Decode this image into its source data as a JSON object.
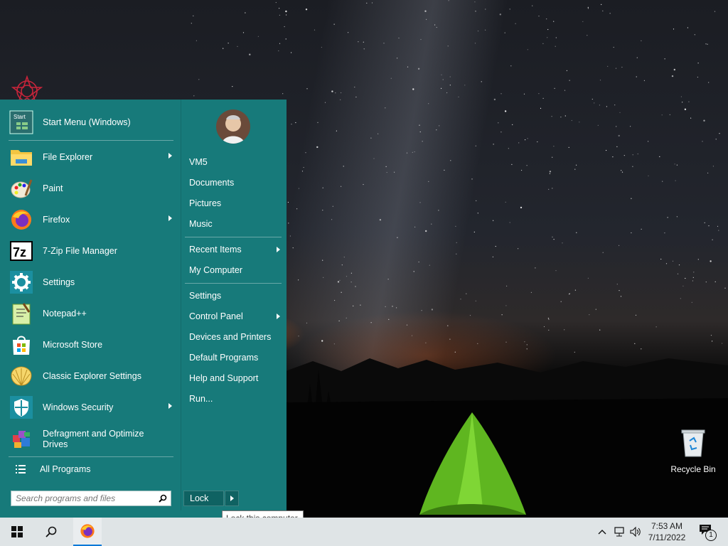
{
  "desktop": {
    "recycle_bin_label": "Recycle Bin"
  },
  "start_menu": {
    "header_item": {
      "label": "Start Menu (Windows)",
      "icon": "start-menu-icon"
    },
    "programs": [
      {
        "label": "File Explorer",
        "icon": "folder-icon",
        "has_submenu": true
      },
      {
        "label": "Paint",
        "icon": "paint-palette-icon",
        "has_submenu": false
      },
      {
        "label": "Firefox",
        "icon": "firefox-icon",
        "has_submenu": true
      },
      {
        "label": "7-Zip File Manager",
        "icon": "7zip-icon",
        "has_submenu": false
      },
      {
        "label": "Settings",
        "icon": "gear-icon",
        "has_submenu": false
      },
      {
        "label": "Notepad++",
        "icon": "notepad-icon",
        "has_submenu": false
      },
      {
        "label": "Microsoft Store",
        "icon": "store-bag-icon",
        "has_submenu": false
      },
      {
        "label": "Classic Explorer Settings",
        "icon": "shell-icon",
        "has_submenu": false
      },
      {
        "label": "Windows Security",
        "icon": "shield-icon",
        "has_submenu": true
      },
      {
        "label": "Defragment and Optimize Drives",
        "icon": "defrag-icon",
        "has_submenu": false
      }
    ],
    "all_programs_label": "All Programs",
    "search_placeholder": "Search programs and files",
    "right_items": {
      "vm5": "VM5",
      "documents": "Documents",
      "pictures": "Pictures",
      "music": "Music",
      "recent_items": "Recent Items",
      "my_computer": "My Computer",
      "settings": "Settings",
      "control_panel": "Control Panel",
      "devices_printers": "Devices and Printers",
      "default_programs": "Default Programs",
      "help_support": "Help and Support",
      "run": "Run..."
    },
    "lock_label": "Lock",
    "lock_tooltip": "Lock this computer."
  },
  "taskbar": {
    "time": "7:53 AM",
    "date": "7/11/2022",
    "notification_count": "1"
  },
  "colors": {
    "start_menu_bg": "#177a7a",
    "taskbar_bg": "#dfe4e6",
    "accent": "#0078d7"
  }
}
